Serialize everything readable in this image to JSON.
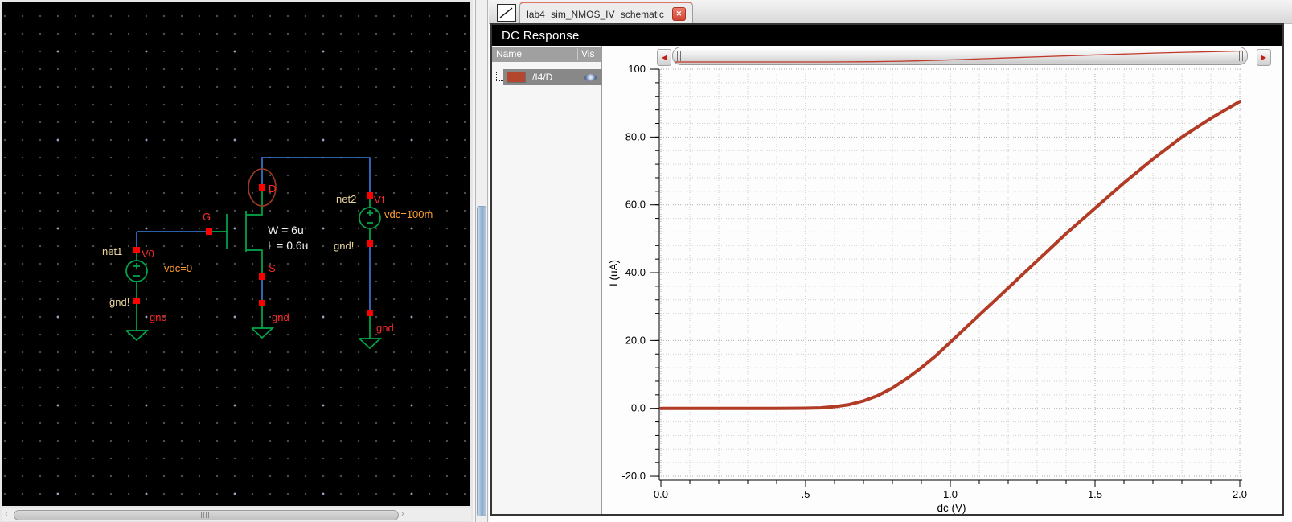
{
  "schematic": {
    "v0": {
      "net": "net1",
      "name": "V0",
      "value": "vdc=0",
      "gnd_node": "gnd!",
      "gnd_symbol": "gnd"
    },
    "nmos": {
      "gate": "G",
      "drain": "D",
      "source": "S",
      "width": "W = 6u",
      "length": "L = 0.6u",
      "gnd_symbol": "gnd"
    },
    "v1": {
      "net": "net2",
      "name": "V1",
      "value": "vdc=100m",
      "gnd_node": "gnd!",
      "gnd_symbol": "gnd"
    }
  },
  "viewer": {
    "tab": {
      "title": "lab4 sim_NMOS_IV schematic",
      "close_glyph": "✕"
    },
    "header_title": "DC Response",
    "signal_panel": {
      "name_col": "Name",
      "vis_col": "Vis",
      "signals": [
        {
          "name": "/I4/D",
          "color": "#b5462e",
          "visible": true
        }
      ]
    }
  },
  "icons": {
    "scroll_left_red": "◀",
    "scroll_right_red": "▶",
    "scroll_left_gray": "‹",
    "scroll_right_gray": "›"
  },
  "colors": {
    "curve": "#b23b26",
    "wire_blue": "#3c7de0",
    "device_green": "#00a84a",
    "pin_red": "#ff0000",
    "label_orange": "#ff9d2e",
    "net_tan": "#e9d49b",
    "highlight_ellipse": "#9c3a22",
    "schem_text_white": "#f2f2f2"
  },
  "chart_data": {
    "type": "line",
    "title": "DC Response",
    "xlabel": "dc (V)",
    "ylabel": "I (uA)",
    "xlim": [
      0,
      2.0
    ],
    "ylim": [
      -20,
      100
    ],
    "x_tick_labels": [
      "0.0",
      ".5",
      "1.0",
      "1.5",
      "2.0"
    ],
    "x_tick_values": [
      0,
      0.5,
      1.0,
      1.5,
      2.0
    ],
    "y_tick_labels": [
      "100",
      "80.0",
      "60.0",
      "40.0",
      "20.0",
      "0.0",
      "-20.0"
    ],
    "y_tick_values": [
      100,
      80,
      60,
      40,
      20,
      0,
      -20
    ],
    "x_minor_step": 0.1,
    "y_minor_step": 4,
    "grid": "dotted",
    "legend_position": "left-panel",
    "series": [
      {
        "name": "/I4/D",
        "color": "#b23b26",
        "x": [
          0,
          0.1,
          0.2,
          0.3,
          0.4,
          0.5,
          0.55,
          0.6,
          0.65,
          0.7,
          0.75,
          0.8,
          0.85,
          0.9,
          0.95,
          1.0,
          1.05,
          1.1,
          1.15,
          1.2,
          1.3,
          1.4,
          1.5,
          1.6,
          1.7,
          1.8,
          1.9,
          2.0
        ],
        "y": [
          0,
          0,
          0,
          0,
          0,
          0.05,
          0.15,
          0.5,
          1.1,
          2.2,
          3.8,
          6.0,
          8.8,
          12.0,
          15.5,
          19.5,
          23.5,
          27.5,
          31.5,
          35.5,
          43.5,
          51.5,
          59.0,
          66.5,
          73.5,
          80.0,
          85.5,
          90.5
        ]
      }
    ]
  }
}
